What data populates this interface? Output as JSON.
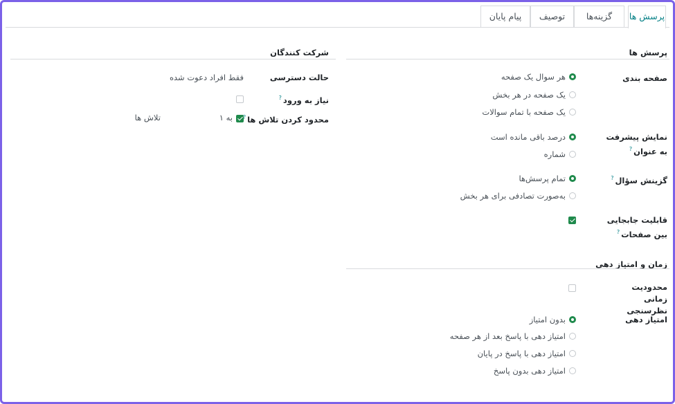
{
  "tabs": [
    {
      "label": "پرسش ها",
      "active": true
    },
    {
      "label": "گزینه‌ها",
      "active": false
    },
    {
      "label": "توصیف",
      "active": false
    },
    {
      "label": "پیام پایان",
      "active": false
    }
  ],
  "questions": {
    "section_title": "پرسش ها",
    "pagination": {
      "label": "صفحه بندی",
      "options": [
        "هر سوال یک صفحه",
        "یک صفحه در هر بخش",
        "یک صفحه با تمام سوالات"
      ],
      "selected": 0
    },
    "progress": {
      "label": "نمایش پیشرفت به عنوان",
      "options": [
        "درصد باقی مانده است",
        "شماره"
      ],
      "selected": 0
    },
    "selection": {
      "label": "گزینش سؤال",
      "options": [
        "تمام پرسش‌ها",
        "به‌صورت تصادفی برای هر بخش"
      ],
      "selected": 0
    },
    "navigation": {
      "label": "قابلیت جابجایی بین صفحات",
      "checked": true
    }
  },
  "time_scoring": {
    "section_title": "زمان و امتیاز دهی",
    "time_limit": {
      "label": "محدودیت زمانی نظرسنجی",
      "checked": false
    },
    "scoring": {
      "label": "امتیاز دهی",
      "options": [
        "بدون امتیاز",
        "امتیاز دهی با پاسخ بعد از هر صفحه",
        "امتیاز دهی با پاسخ در پایان",
        "امتیاز دهی بدون پاسخ"
      ],
      "selected": 0
    }
  },
  "participants": {
    "section_title": "شرکت کنندگان",
    "access_mode": {
      "label": "حالت دسترسی",
      "value": "فقط افراد دعوت شده"
    },
    "login_required": {
      "label": "نیاز به ورود",
      "checked": false
    },
    "limit_attempts": {
      "label": "محدود کردن تلاش ها",
      "checked": true,
      "to_label": "به ۱",
      "attempts_label": "تلاش ها"
    }
  },
  "colors": {
    "accent": "#017e84",
    "check_green": "#1f8a4c",
    "frame": "#7b61e8"
  }
}
